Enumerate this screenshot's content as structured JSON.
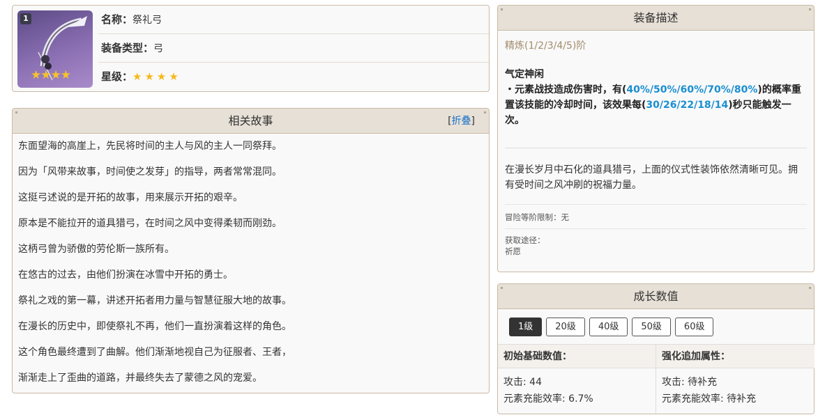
{
  "info": {
    "icon_level": "1",
    "icon_stars": "★★★★",
    "name_label": "名称：",
    "name_value": "祭礼弓",
    "type_label": "装备类型：",
    "type_value": "弓",
    "rarity_label": "星级：",
    "rarity_value": "★★★★"
  },
  "story": {
    "title": "相关故事",
    "fold_open": "[",
    "fold_text": "折叠",
    "fold_close": "]",
    "lines": [
      "东面望海的高崖上，先民将时间的主人与风的主人一同祭拜。",
      "因为「风带来故事，时间使之发芽」的指导，两者常常混同。",
      "这挺弓述说的是开拓的故事，用来展示开拓的艰辛。",
      "原本是不能拉开的道具猎弓，在时间之风中变得柔韧而刚劲。",
      "这柄弓曾为骄傲的劳伦斯一族所有。",
      "在悠古的过去，由他们扮演在冰雪中开拓的勇士。",
      "祭礼之戏的第一幕，讲述开拓者用力量与智慧征服大地的故事。",
      "在漫长的历史中，即使祭礼不再，他们一直扮演着这样的角色。",
      "这个角色最终遭到了曲解。他们渐渐地视自己为征服者、王者，",
      "渐渐走上了歪曲的道路，并最终失去了蒙德之风的宠爱。"
    ]
  },
  "desc": {
    "title": "装备描述",
    "refine": "精炼(1/2/3/4/5)阶",
    "skill_name": "气定神闲",
    "skill_p1": "・元素战技造成伤害时，有(",
    "skill_h1": "40%/50%/60%/70%/80%",
    "skill_p2": ")的概率重置该技能的冷却时间，该效果每(",
    "skill_h2": "30/26/22/18/14",
    "skill_p3": ")秒只能触发一次。",
    "flavor": "在漫长岁月中石化的道具猎弓，上面的仪式性装饰依然清晰可见。拥有受时间之风冲刷的祝福力量。",
    "rank_limit": "冒险等阶限制：无",
    "source_label": "获取途径：",
    "source_value": "祈愿"
  },
  "growth": {
    "title": "成长数值",
    "levels": [
      "1级",
      "20级",
      "40级",
      "50级",
      "60级"
    ],
    "base_header": "初始基础数值：",
    "bonus_header": "强化追加属性：",
    "base_atk": "攻击: 44",
    "base_er": "元素充能效率: 6.7%",
    "bonus_atk": "攻击: 待补充",
    "bonus_er": "元素充能效率: 待补充"
  },
  "colors": {
    "accent": "#1a8fd1",
    "refine": "#a38b6b",
    "star": "#f5b919",
    "header_bg": "#e7e0d6"
  }
}
